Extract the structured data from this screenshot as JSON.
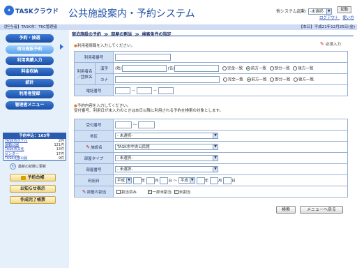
{
  "header": {
    "logo_text": "TASKクラウド",
    "app_title": "公共施設案内・予約システム",
    "system_start_label": "他システム起動:",
    "system_select_value": "-未選択-",
    "start_button": "起動",
    "logout_link": "ログアウト",
    "help_link": "使い方"
  },
  "info_bar": {
    "left": "【担当者】TASK市：TKC管理者",
    "right": "【本日】平成21年12月25日(金)"
  },
  "sidebar": {
    "nav": [
      {
        "label": "予約・抽選"
      },
      {
        "label": "宿泊施設予約"
      },
      {
        "label": "利用実績入力"
      },
      {
        "label": "料金収納"
      },
      {
        "label": "統計"
      },
      {
        "label": "利用者登録"
      },
      {
        "label": "管理者メニュー"
      }
    ],
    "apply_title": "予約申込：163件",
    "apply_rows": [
      {
        "name": "TASK市ホテル",
        "count": "2件"
      },
      {
        "name": "運動公園",
        "count": "121件"
      },
      {
        "name": "TASK市文化",
        "count": "13件"
      },
      {
        "name": "センター",
        "count": "17件"
      },
      {
        "name": "TASK北部公民",
        "count": "9件"
      }
    ],
    "refresh_label": "最新の状態に更新",
    "yellow_buttons": [
      "予約台帳",
      "お知らせ表示",
      "作成完了帳票"
    ]
  },
  "breadcrumb": [
    "宿泊施設の予約",
    "部屋の割当",
    "検索条件の指定"
  ],
  "user_section": {
    "note": "利用者情報を入力してください。",
    "required_label": "必須入力",
    "user_no_label": "利用者番号",
    "name_label_1": "利用者名",
    "name_label_2": "／団体名",
    "kanji_label": "漢字",
    "kana_label": "カナ",
    "sei": "(姓)",
    "mei": "(名)",
    "match_options": [
      "完全一致",
      "前方一致",
      "部分一致",
      "後方一致"
    ],
    "match_selected": "前方一致",
    "phone_label": "電話番号",
    "dash": "－"
  },
  "reservation_section": {
    "note_line1": "予約内容を入力してください。",
    "note_line2": "受付番号、利用日が未入力のときは本日以降に利用される予約を検索の対象とします。",
    "receipt_label": "受付番号",
    "tilde": "～",
    "area_label": "地区",
    "area_value": "- 未選択-",
    "facility_label": "施設名",
    "facility_value": "TASK市中央公民館",
    "room_type_label": "部屋タイプ",
    "room_type_value": "- 未選択-",
    "room_no_label": "部屋番号",
    "room_no_value": "- 未選択-",
    "use_date_label": "利用日",
    "era_value": "平成",
    "year": "年",
    "month": "月",
    "day": "日",
    "assign_label": "部屋の割当",
    "assign_options": [
      {
        "label": "割当済み",
        "checked": false
      },
      {
        "label": "一部未割当",
        "checked": true
      },
      {
        "label": "未割当",
        "checked": true
      }
    ]
  },
  "buttons": {
    "search": "検索",
    "back": "メニューへ戻る"
  },
  "colors": {
    "brand_blue": "#1d4ea8",
    "required_red": "#c8262a",
    "label_bg": "#cfe0f5"
  }
}
